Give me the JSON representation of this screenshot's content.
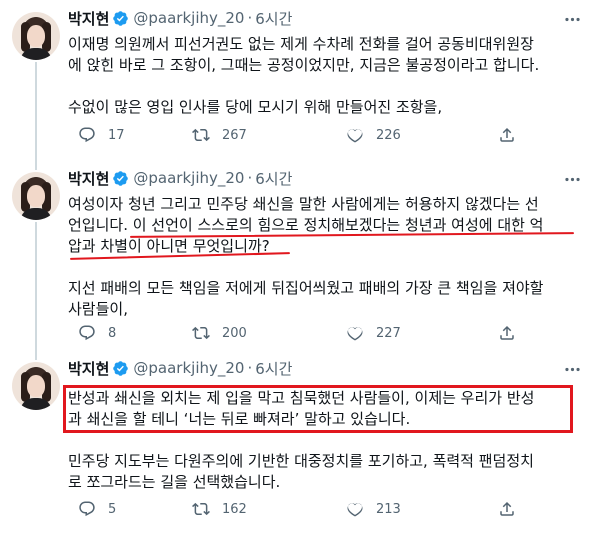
{
  "tweets": [
    {
      "author_name": "박지현",
      "handle": "@paarkjihy_20",
      "separator": "·",
      "time": "6시간",
      "lines": [
        "이재명 의원께서 피선거권도 없는 제게 수차례 전화를 걸어 공동비대위원장",
        "에 앉힌 바로 그 조항이, 그때는 공정이었지만, 지금은 불공정이라고 합니다."
      ],
      "lines2": [
        "수없이 많은 영입 인사를 당에 모시기 위해 만들어진 조항을,"
      ],
      "replies": "17",
      "retweets": "267",
      "likes": "226"
    },
    {
      "author_name": "박지현",
      "handle": "@paarkjihy_20",
      "separator": "·",
      "time": "6시간",
      "lines": [
        "여성이자 청년 그리고 민주당 쇄신을 말한 사람에게는 허용하지 않겠다는 선",
        "언입니다. 이 선언이 스스로의 힘으로 정치해보겠다는 청년과 여성에 대한 억",
        "압과 차별이 아니면 무엇입니까?"
      ],
      "lines2": [
        "지선 패배의 모든 책임을 저에게 뒤집어씌웠고 패배의 가장 큰 책임을 져야할",
        "사람들이,"
      ],
      "replies": "8",
      "retweets": "200",
      "likes": "227"
    },
    {
      "author_name": "박지현",
      "handle": "@paarkjihy_20",
      "separator": "·",
      "time": "6시간",
      "lines": [
        "반성과 쇄신을 외치는 제 입을 막고 침묵했던 사람들이, 이제는 우리가 반성",
        "과 쇄신을 할 테니 ‘너는 뒤로 빠져라’ 말하고 있습니다."
      ],
      "lines2": [
        "민주당 지도부는 다원주의에 기반한 대중정치를 포기하고, 폭력적 팬덤정치",
        "로 쪼그라드는 길을 선택했습니다."
      ],
      "replies": "5",
      "retweets": "162",
      "likes": "213"
    }
  ],
  "icons": {
    "verified": "verified-badge-icon",
    "more": "more-options-icon",
    "reply": "reply-icon",
    "retweet": "retweet-icon",
    "like": "like-icon",
    "share": "share-icon"
  },
  "colors": {
    "verified_blue": "#1d9bf0",
    "secondary_text": "#536471",
    "annotation_red": "#e1171e",
    "thread_line": "#cfd9de"
  }
}
